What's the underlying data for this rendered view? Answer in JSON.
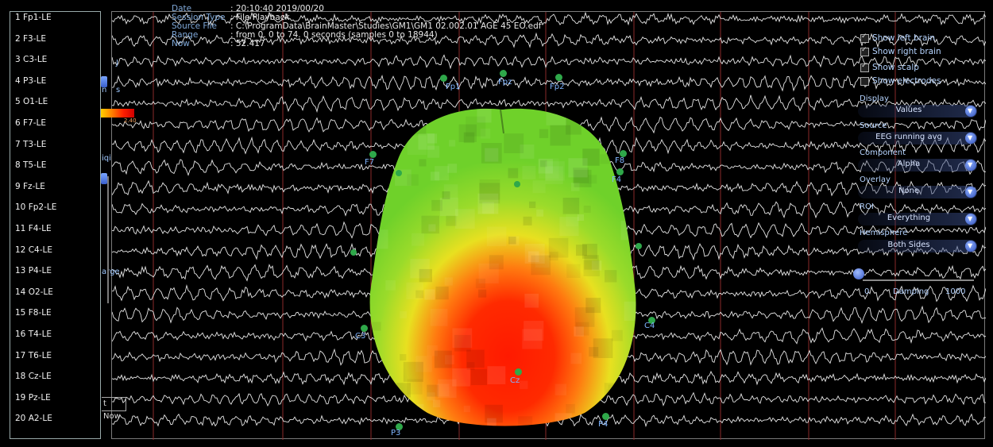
{
  "session": {
    "date_label": "Date",
    "date_value": ": 20:10:40 2019/00/20",
    "type_label": "Session Type",
    "type_value": ": File Playback",
    "source_label": "Source File",
    "source_value": ": C:\\ProgramData\\BrainMaster\\Studies\\GM1\\GM1 02.002.01 AGE 45 EO.edf",
    "range_label": "Range",
    "range_value": ": from 0. 0 to 74. 0 seconds (samples 0 to 18944)",
    "now_label": "Now",
    "now_value": ": 52.417"
  },
  "channels": [
    "1 Fp1-LE",
    "2 F3-LE",
    "3 C3-LE",
    "4 P3-LE",
    "5 O1-LE",
    "6 F7-LE",
    "7 T3-LE",
    "8 T5-LE",
    "9 Fz-LE",
    "10 Fp2-LE",
    "11 F4-LE",
    "12 C4-LE",
    "13 P4-LE",
    "14 O2-LE",
    "15 F8-LE",
    "16 T4-LE",
    "17 T6-LE",
    "18 Cz-LE",
    "19 Pz-LE",
    "20 A2-LE"
  ],
  "electrodes": [
    "Fp1",
    "Fpz",
    "Fp2",
    "F7",
    "F8",
    "F4",
    "C3",
    "C4",
    "Cz",
    "P3",
    "P4"
  ],
  "left_controls": {
    "scale_max": "2.40",
    "not_now": "t Now",
    "stub_n": "n",
    "stub_s": "s",
    "stub_j": "J",
    "stub_iqi": "iqi",
    "stub_arge": "arge"
  },
  "right_panel": {
    "show_left_brain": "Show left brain",
    "show_right_brain": "Show right brain",
    "show_scalp": "Show scalp",
    "show_electrodes": "Show electrodes",
    "display_label": "Display",
    "display_value": "Values",
    "source_label": "Source",
    "source_value": "EEG running avg",
    "component_label": "Component",
    "component_value": "Alpha",
    "overlay_label": "Overlay",
    "overlay_value": "None",
    "roi_label": "ROI",
    "roi_value": "Everything",
    "hemisphere_label": "Hemisphere",
    "hemisphere_value": "Both Sides",
    "damping_min": "0",
    "damping_label": "Damping",
    "damping_max": "1000"
  },
  "colors": {
    "background": "#000000",
    "trace": "#e6e6e6",
    "marker": "#8a2a2a",
    "electrode": "#2fa84a",
    "label_blue": "#7fb4ff"
  }
}
